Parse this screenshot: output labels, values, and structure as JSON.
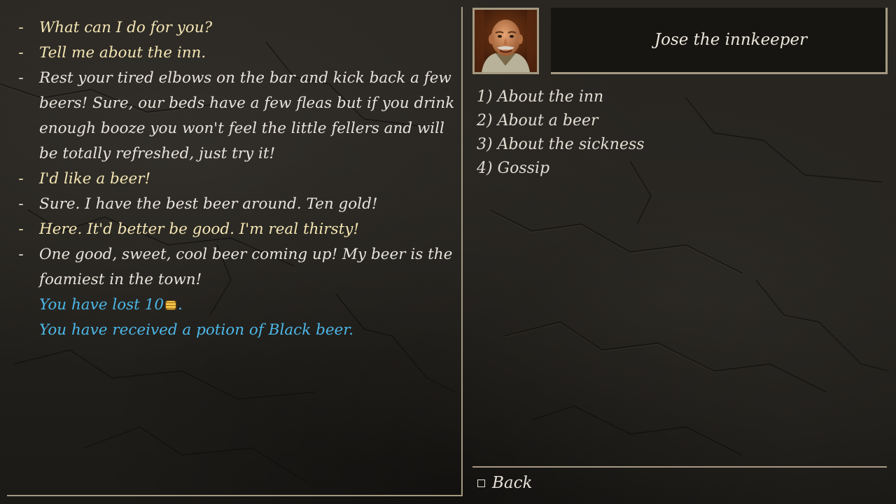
{
  "npc": {
    "name": "Jose the innkeeper",
    "portrait": "innkeeper-portrait"
  },
  "log": [
    {
      "type": "player",
      "dash": "-",
      "text": "What can I do for you?"
    },
    {
      "type": "player",
      "dash": "-",
      "text": "Tell me about the inn."
    },
    {
      "type": "npc",
      "dash": "-",
      "text": "Rest your tired elbows on the bar and kick back a few beers! Sure, our beds have a few fleas but if you drink enough booze you won't feel the little fellers and will be totally refreshed, just try it!"
    },
    {
      "type": "player",
      "dash": "-",
      "text": "I'd like a beer!"
    },
    {
      "type": "npc",
      "dash": "-",
      "text": "Sure. I have the best beer around. Ten gold!"
    },
    {
      "type": "player",
      "dash": "-",
      "text": "Here. It'd better be good. I'm real thirsty!"
    },
    {
      "type": "npc",
      "dash": "-",
      "text": "One good, sweet, cool beer coming up! My beer is the foamiest in the town!"
    }
  ],
  "system_messages": {
    "lost_prefix": "You have lost 10",
    "lost_suffix": ".",
    "received": "You have received a potion of Black beer."
  },
  "options": [
    "1) About the inn",
    "2) About a beer",
    "3) About the sickness",
    "4) Gossip"
  ],
  "back_label": "Back",
  "colors": {
    "system_text": "#4cb8e8",
    "frame": "#a59a82"
  }
}
